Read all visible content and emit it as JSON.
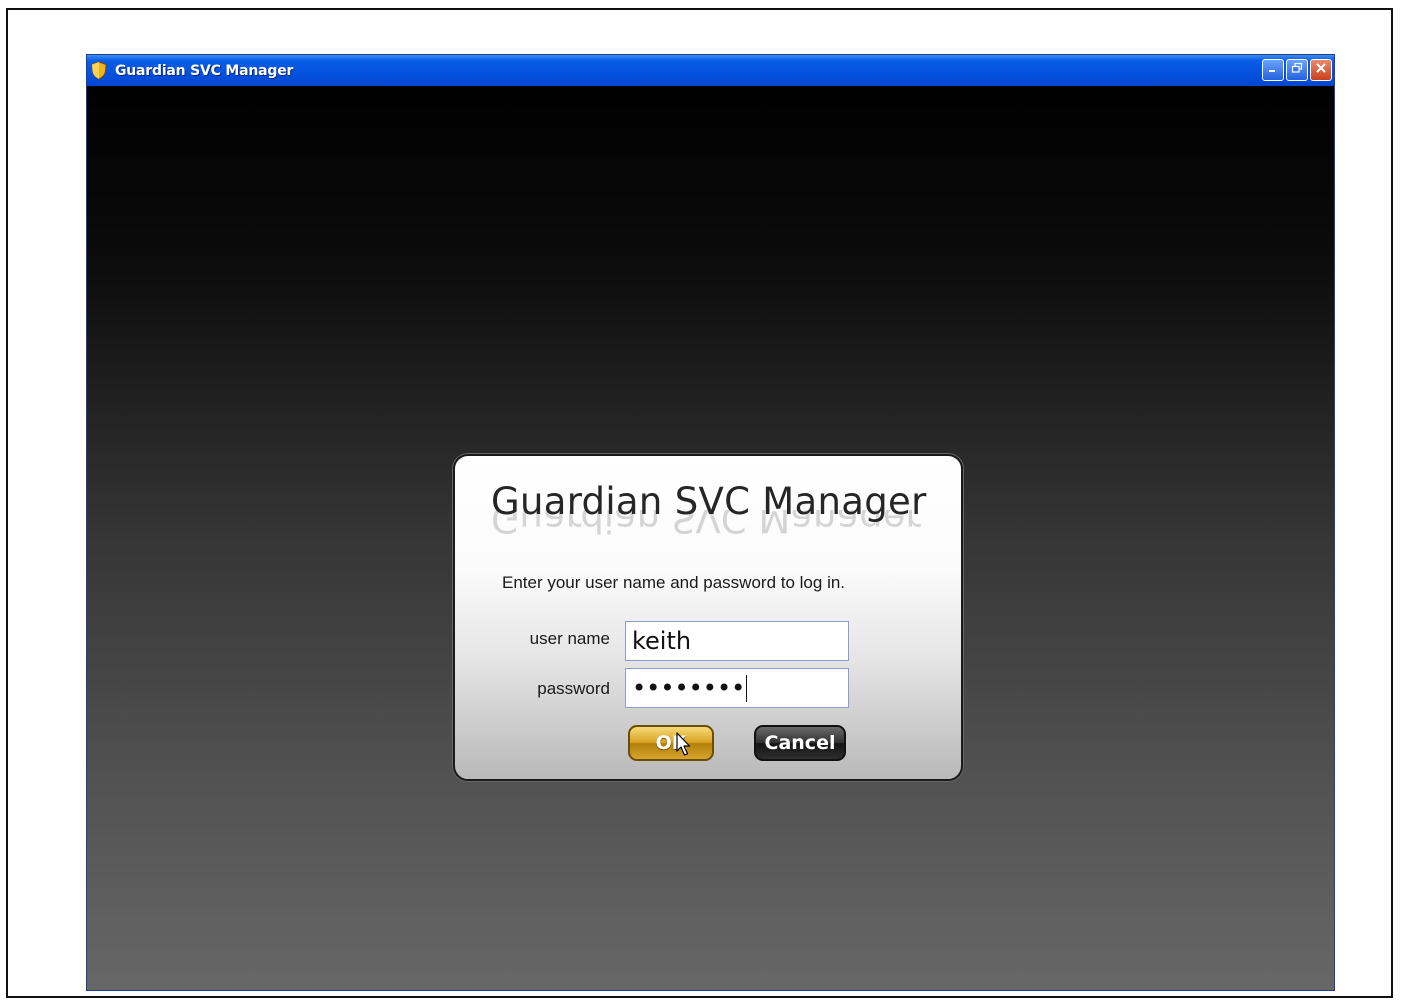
{
  "window": {
    "title": "Guardian SVC Manager",
    "icon": "shield-icon",
    "controls": [
      "minimize-icon",
      "restore-icon",
      "close-icon"
    ]
  },
  "login_dialog": {
    "title": "Guardian SVC Manager",
    "instructions": "Enter your user name and password to log in.",
    "username_label": "user name",
    "username_value": "keith",
    "password_label": "password",
    "password_mask": "••••••••",
    "ok_label": "OK",
    "cancel_label": "Cancel"
  },
  "colors": {
    "titlebar": "#0551dd",
    "ok_button": "#dba324",
    "cancel_button": "#333333",
    "dialog_background": "#f4f4f4"
  }
}
